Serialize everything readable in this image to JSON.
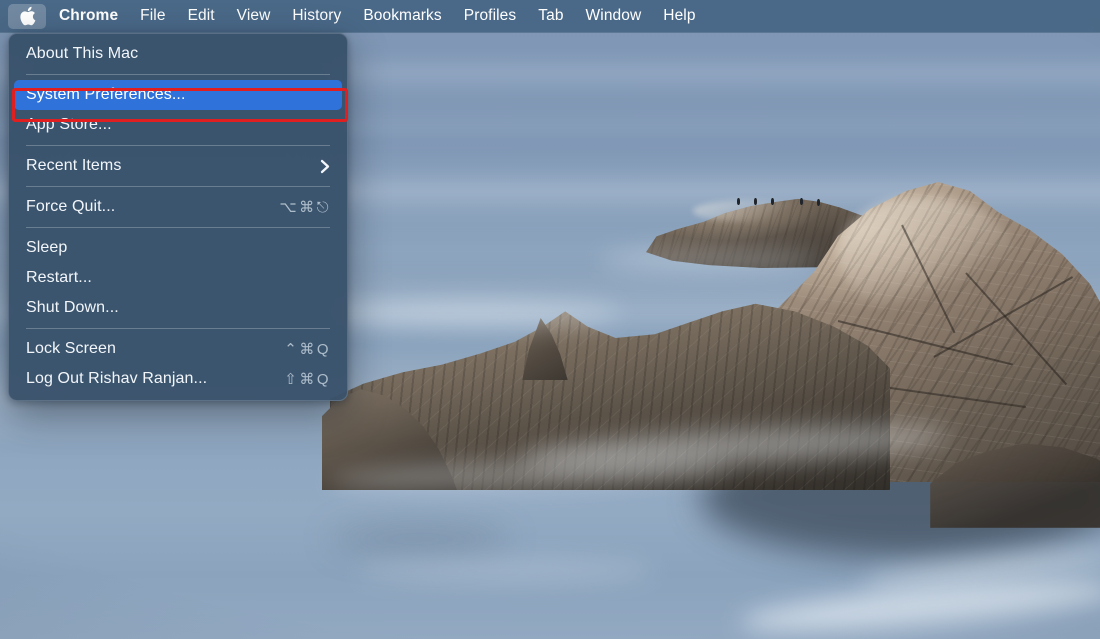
{
  "menubar": {
    "apple_icon": "apple-logo-icon",
    "items": [
      {
        "label": "Chrome",
        "bold": true
      },
      {
        "label": "File"
      },
      {
        "label": "Edit"
      },
      {
        "label": "View"
      },
      {
        "label": "History"
      },
      {
        "label": "Bookmarks"
      },
      {
        "label": "Profiles"
      },
      {
        "label": "Tab"
      },
      {
        "label": "Window"
      },
      {
        "label": "Help"
      }
    ]
  },
  "apple_menu": {
    "items": [
      {
        "label": "About This Mac",
        "shortcut": "",
        "selected": false,
        "submenu": false
      },
      {
        "separator": true
      },
      {
        "label": "System Preferences...",
        "shortcut": "",
        "selected": true,
        "submenu": false
      },
      {
        "label": "App Store...",
        "shortcut": "",
        "selected": false,
        "submenu": false
      },
      {
        "separator": true
      },
      {
        "label": "Recent Items",
        "shortcut": "",
        "selected": false,
        "submenu": true
      },
      {
        "separator": true
      },
      {
        "label": "Force Quit...",
        "shortcut": "⌥⌘⎋",
        "selected": false,
        "submenu": false
      },
      {
        "separator": true
      },
      {
        "label": "Sleep",
        "shortcut": "",
        "selected": false,
        "submenu": false
      },
      {
        "label": "Restart...",
        "shortcut": "",
        "selected": false,
        "submenu": false
      },
      {
        "label": "Shut Down...",
        "shortcut": "",
        "selected": false,
        "submenu": false
      },
      {
        "separator": true
      },
      {
        "label": "Lock Screen",
        "shortcut": "⌃⌘Q",
        "selected": false,
        "submenu": false
      },
      {
        "label": "Log Out Rishav Ranjan...",
        "shortcut": "⇧⌘Q",
        "selected": false,
        "submenu": false
      }
    ]
  },
  "annotation": {
    "target": "System Preferences...",
    "color": "#e02020"
  },
  "colors": {
    "menubar_bg": "#4e6e8c",
    "menu_bg": "#3e556b",
    "highlight_blue": "#2f72da",
    "menu_text": "#f2f6fa",
    "shortcut_text": "#aebdcb",
    "wallpaper_water": "#8ba3bd"
  },
  "wallpaper": {
    "name": "macos-coastal-rocks-wallpaper",
    "description": "Long-exposure seascape with rock formations"
  }
}
